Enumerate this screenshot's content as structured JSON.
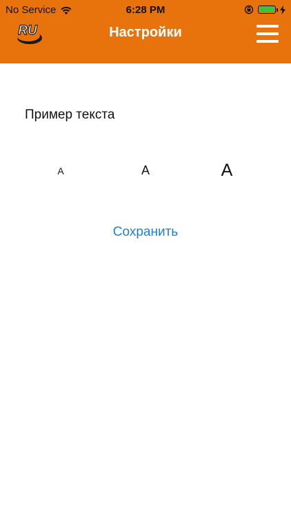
{
  "status_bar": {
    "carrier": "No Service",
    "time": "6:28 PM",
    "wifi_icon": "wifi-icon",
    "lock_icon": "orientation-lock-icon",
    "battery_icon": "battery-icon",
    "charging_icon": "charging-bolt-icon",
    "battery_level": 1.0
  },
  "nav": {
    "logo_text": "RU",
    "title": "Настройки",
    "menu_icon": "hamburger-menu-icon"
  },
  "content": {
    "sample_text": "Пример текста",
    "font_sizes": {
      "small": "A",
      "medium": "A",
      "large": "A"
    },
    "save_label": "Сохранить"
  },
  "colors": {
    "brand": "#E8730C",
    "link": "#1E7FD6",
    "background": "#FFFFFF"
  }
}
